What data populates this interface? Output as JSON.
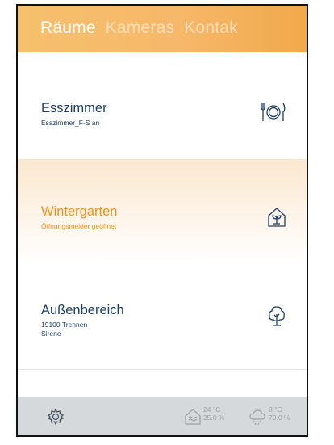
{
  "tabs": [
    "Räume",
    "Kameras",
    "Kontak"
  ],
  "rooms": [
    {
      "name": "Esszimmer",
      "lines": [
        "Esszimmer_F-S an"
      ],
      "icon": "dining-icon"
    },
    {
      "name": "Wintergarten",
      "lines": [
        "Öffnungsmelder geöffnet"
      ],
      "icon": "greenhouse-icon"
    },
    {
      "name": "Außenbereich",
      "lines": [
        "19100 Trennen",
        "Sirene"
      ],
      "icon": "tree-icon"
    }
  ],
  "footer": {
    "indoor": {
      "temp": "24 °C",
      "humidity": "25.0 %",
      "icon": "indoor-climate-icon"
    },
    "outdoor": {
      "temp": "8 °C",
      "humidity": "79.0 %",
      "icon": "rain-cloud-icon"
    },
    "settings_icon": "gear-icon"
  },
  "colors": {
    "accent": "#f6b86a",
    "highlight": "#ef8f1c",
    "text": "#1d3f6a"
  }
}
